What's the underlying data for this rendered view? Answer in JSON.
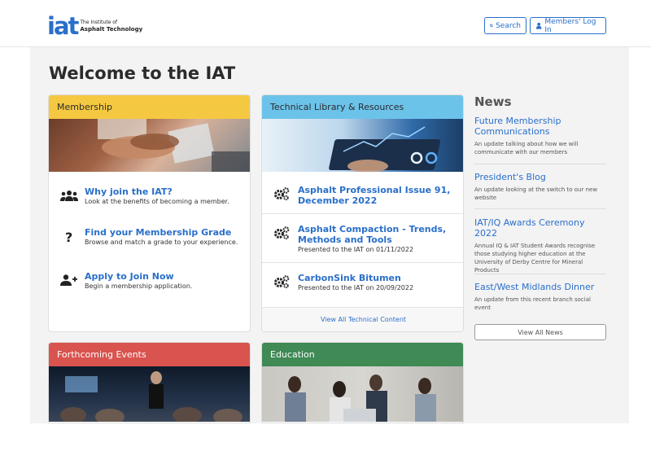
{
  "header": {
    "logo_mark": "iat",
    "logo_line1": "The Institute of",
    "logo_line2": "Asphalt Technology",
    "search_label": "Search",
    "login_label": "Members' Log In"
  },
  "page_title": "Welcome to the IAT",
  "membership": {
    "heading": "Membership",
    "items": [
      {
        "icon": "users-icon",
        "title": "Why join the IAT?",
        "desc": "Look at the benefits of becoming a member."
      },
      {
        "icon": "question-icon",
        "title": "Find your Membership Grade",
        "desc": "Browse and match a grade to your experience."
      },
      {
        "icon": "user-plus-icon",
        "title": "Apply to Join Now",
        "desc": "Begin a membership application."
      }
    ]
  },
  "library": {
    "heading": "Technical Library & Resources",
    "items": [
      {
        "icon": "cogs-icon",
        "title": "Asphalt Professional Issue 91, December 2022",
        "desc": ""
      },
      {
        "icon": "cogs-icon",
        "title": "Asphalt Compaction - Trends, Methods and Tools",
        "desc": "Presented to the IAT on 01/11/2022"
      },
      {
        "icon": "cogs-icon",
        "title": "CarbonSink Bitumen",
        "desc": "Presented to the IAT on 20/09/2022"
      }
    ],
    "view_all": "View All Technical Content"
  },
  "events": {
    "heading": "Forthcoming Events"
  },
  "education": {
    "heading": "Education"
  },
  "news": {
    "heading": "News",
    "items": [
      {
        "title": "Future Membership Communications",
        "desc": "An update talking about how we will communicate with our members"
      },
      {
        "title": "President's Blog",
        "desc": "An update looking at the switch to our new website"
      },
      {
        "title": "IAT/IQ Awards Ceremony 2022",
        "desc": "Annual IQ & IAT Student Awards recognise those studying higher education at the University of Derby Centre for Mineral Products"
      },
      {
        "title": "East/West Midlands Dinner",
        "desc": "An update from this recent branch social event"
      }
    ],
    "view_all": "View All News"
  },
  "colors": {
    "brand_blue": "#2a6fc9",
    "membership_head": "#f5c842",
    "library_head": "#6cc3ea",
    "events_head": "#d9534f",
    "education_head": "#3f8a55"
  }
}
